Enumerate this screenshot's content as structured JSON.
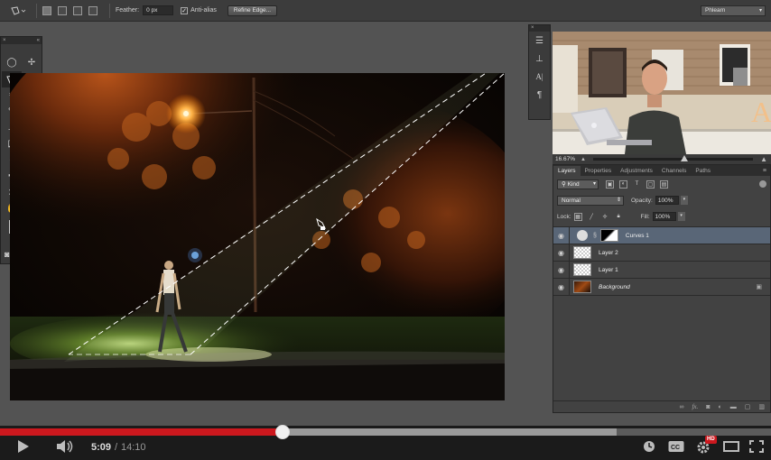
{
  "options_bar": {
    "feather_label": "Feather:",
    "feather_value": "0 px",
    "antialias_label": "Anti-alias",
    "antialias_checked": "✓",
    "refine_edge_label": "Refine Edge...",
    "workspace_label": "Phlearn"
  },
  "tools": {
    "items": [
      "ellipse-marquee",
      "move",
      "polygonal-lasso",
      "magic-wand",
      "crop",
      "eyedropper",
      "healing-brush",
      "brush",
      "clone-stamp",
      "history-brush",
      "eraser",
      "gradient",
      "blur",
      "dodge",
      "pen",
      "type",
      "path-selection",
      "rectangle",
      "hand",
      "zoom"
    ]
  },
  "webcam": {
    "zoom_value": "16.67%",
    "zoom_fraction": 0.57
  },
  "layers_panel": {
    "tabs": [
      "Layers",
      "Properties",
      "Adjustments",
      "Channels",
      "Paths"
    ],
    "filter_kind": "Kind",
    "blend_mode": "Normal",
    "opacity_label": "Opacity:",
    "opacity_value": "100%",
    "lock_label": "Lock:",
    "fill_label": "Fill:",
    "fill_value": "100%",
    "layers": [
      {
        "name": "Curves 1",
        "selected": true
      },
      {
        "name": "Layer 2",
        "selected": false
      },
      {
        "name": "Layer 1",
        "selected": false
      },
      {
        "name": "Background",
        "selected": false
      }
    ]
  },
  "video": {
    "current_time": "5:09",
    "separator": "/",
    "total_time": "14:10",
    "played_fraction": 0.366,
    "buffered_fraction": 0.8,
    "hd_label": "HD"
  },
  "colors": {
    "progress_red": "#cc181e",
    "selected_layer": "#596677",
    "street_light": "#ffb347"
  }
}
